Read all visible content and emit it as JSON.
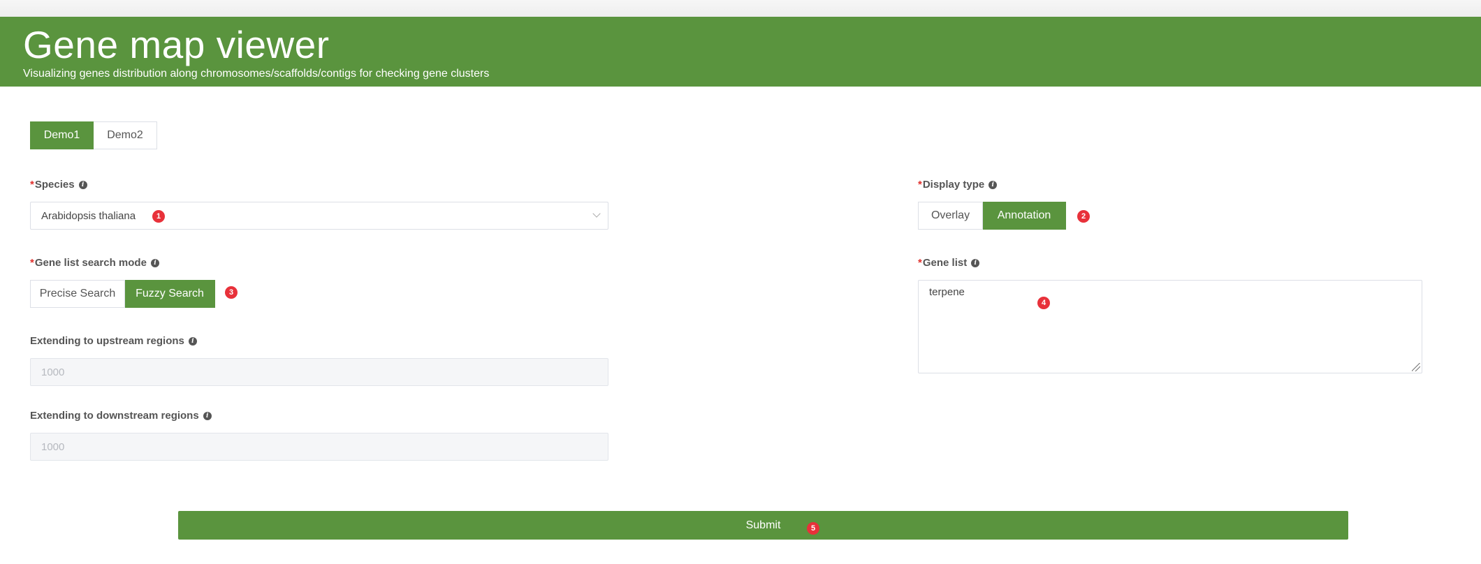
{
  "header": {
    "title": "Gene map viewer",
    "subtitle": "Visualizing genes distribution along chromosomes/scaffolds/contigs for checking gene clusters"
  },
  "demo_tabs": [
    {
      "label": "Demo1",
      "active": true
    },
    {
      "label": "Demo2",
      "active": false
    }
  ],
  "species": {
    "required_mark": "*",
    "label": "Species",
    "value": "Arabidopsis thaliana"
  },
  "display_type": {
    "required_mark": "*",
    "label": "Display type",
    "options": [
      {
        "label": "Overlay",
        "active": false
      },
      {
        "label": "Annotation",
        "active": true
      }
    ]
  },
  "search_mode": {
    "required_mark": "*",
    "label": "Gene list search mode",
    "options": [
      {
        "label": "Precise Search",
        "active": false
      },
      {
        "label": "Fuzzy Search",
        "active": true
      }
    ]
  },
  "gene_list": {
    "required_mark": "*",
    "label": "Gene list",
    "value": "terpene"
  },
  "upstream": {
    "label": "Extending to upstream regions",
    "placeholder": "1000"
  },
  "downstream": {
    "label": "Extending to downstream regions",
    "placeholder": "1000"
  },
  "submit_label": "Submit",
  "markers": [
    "1",
    "2",
    "3",
    "4",
    "5"
  ],
  "icons": {
    "info": "info-icon",
    "dropdown": "chevron-down-icon",
    "resize": "resize-grip-icon"
  },
  "colors": {
    "brand_green": "#5a943e",
    "required_red": "#e0302c",
    "marker_red": "#e8313a"
  }
}
